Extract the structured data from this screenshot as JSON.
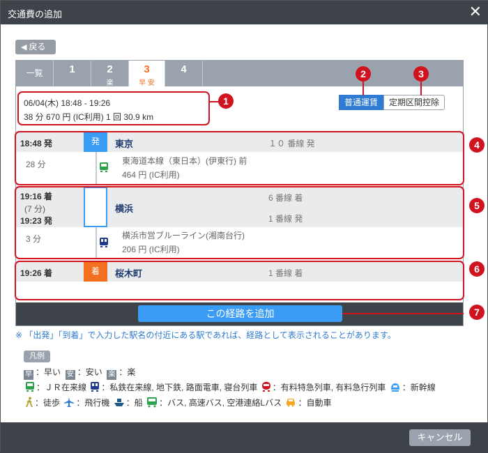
{
  "dialog": {
    "title": "交通費の追加",
    "close": "✕"
  },
  "back_label": "戻る",
  "tabs": [
    {
      "label": "一覧"
    },
    {
      "num": "1",
      "tags": ""
    },
    {
      "num": "2",
      "tags": "楽"
    },
    {
      "num": "3",
      "tags": "早 安"
    },
    {
      "num": "4",
      "tags": ""
    }
  ],
  "summary": {
    "line1": "06/04(木) 18:48 - 19:26",
    "line2": "38 分 670 円 (IC利用) 1 回 30.9 km"
  },
  "fare_toggle": {
    "normal": "普通運賃",
    "commuter": "定期区間控除"
  },
  "route": {
    "origin": {
      "time": "18:48 発",
      "badge": "発",
      "station": "東京",
      "platform": "１０ 番線 発"
    },
    "seg1": {
      "duration": "28 分",
      "line": "東海道本線（東日本）(伊東行) 前",
      "fare": "464 円 (IC利用)"
    },
    "transfer": {
      "arr_time": "19:16 着",
      "wait": "(7 分)",
      "dep_time": "19:23 発",
      "station": "横浜",
      "arr_platform": "6 番線 着",
      "dep_platform": "1 番線 発"
    },
    "seg2": {
      "duration": "3 分",
      "line": "横浜市営ブルーライン(湘南台行)",
      "fare": "206 円 (IC利用)"
    },
    "dest": {
      "time": "19:26 着",
      "badge": "着",
      "station": "桜木町",
      "platform": "1 番線 着"
    }
  },
  "add_button": "この経路を追加",
  "note": "※ 「出発」「到着」で入力した駅名の付近にある駅であれば、経路として表示されることがあります。",
  "legend": {
    "title": "凡例",
    "fast_sq": "早",
    "fast": "：早い",
    "cheap_sq": "安",
    "cheap": "：安い",
    "easy_sq": "楽",
    "easy": "：楽",
    "jr": "：ＪＲ在来線",
    "private": "：私鉄在来線, 地下鉄, 路面電車, 寝台列車",
    "express": "：有料特急列車, 有料急行列車",
    "shinkansen": "：新幹線",
    "walk": "：徒歩",
    "plane": "：飛行機",
    "ship": "：船",
    "bus": "：バス, 高速バス, 空港連絡Lバス",
    "car": "：自動車"
  },
  "callouts": [
    "1",
    "2",
    "3",
    "4",
    "5",
    "6",
    "7"
  ],
  "cancel_label": "キャンセル",
  "colors": {
    "accent_blue": "#2e7bd1",
    "depart_badge": "#3b9cf5",
    "arrive_badge": "#f37021",
    "callout_red": "#d0131e",
    "jr_green": "#2aa34a",
    "subway_navy": "#1f3a8a"
  }
}
